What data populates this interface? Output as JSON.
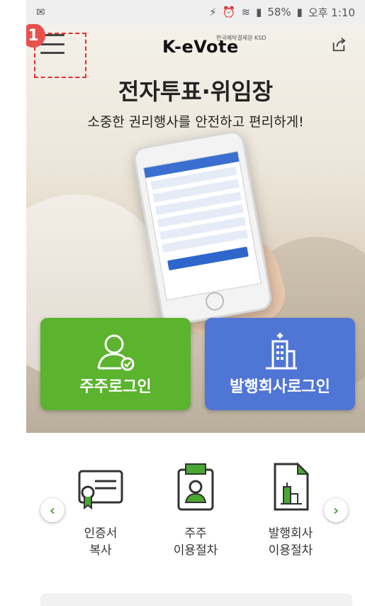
{
  "status_bar": {
    "battery": "58%",
    "time": "오후 1:10"
  },
  "header": {
    "logo": "K-eVote",
    "logo_sub": "한국예탁결제원 KSD",
    "step_number": "1"
  },
  "hero": {
    "title": "전자투표·위임장",
    "subtitle": "소중한 권리행사를 안전하고 편리하게!"
  },
  "login_tiles": [
    {
      "label": "주주로그인",
      "color": "#5bb32e"
    },
    {
      "label": "발행회사로그인",
      "color": "#4f75d5"
    }
  ],
  "quick_menu": [
    {
      "line1": "인증서",
      "line2": "복사",
      "icon": "certificate-icon"
    },
    {
      "line1": "주주",
      "line2": "이용절차",
      "icon": "shareholder-card-icon"
    },
    {
      "line1": "발행회사",
      "line2": "이용절차",
      "icon": "company-document-icon"
    }
  ],
  "accent_color": "#4aa733"
}
